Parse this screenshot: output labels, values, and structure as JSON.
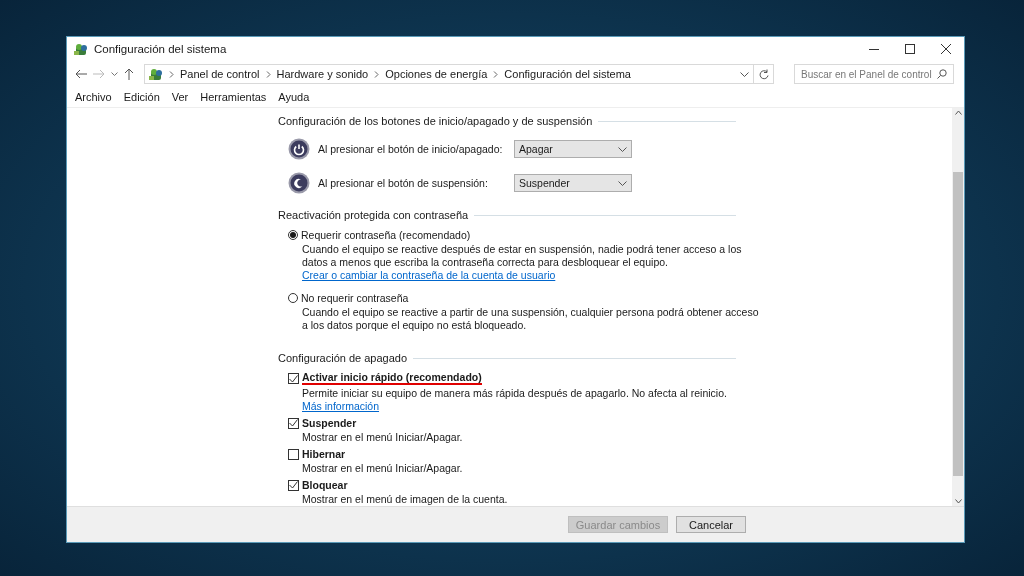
{
  "window": {
    "title": "Configuración del sistema"
  },
  "address": {
    "breadcrumbs": [
      "Panel de control",
      "Hardware y sonido",
      "Opciones de energía",
      "Configuración del sistema"
    ],
    "search": {
      "placeholder": "Buscar en el Panel de control"
    }
  },
  "menu": [
    "Archivo",
    "Edición",
    "Ver",
    "Herramientas",
    "Ayuda"
  ],
  "power_buttons": {
    "heading": "Configuración de los botones de inicio/apagado y de suspensión",
    "rows": [
      {
        "kind": "power",
        "label": "Al presionar el botón de inicio/apagado:",
        "value": "Apagar"
      },
      {
        "kind": "sleep",
        "label": "Al presionar el botón de suspensión:",
        "value": "Suspender"
      }
    ]
  },
  "password": {
    "heading": "Reactivación protegida con contraseña",
    "options": [
      {
        "label": "Requerir contraseña (recomendado)",
        "description": "Cuando el equipo se reactive después de estar en suspensión, nadie podrá tener acceso a los datos a menos que escriba la contraseña correcta para desbloquear el equipo.",
        "link": "Crear o cambiar la contraseña de la cuenta de usuario",
        "selected": true
      },
      {
        "label": "No requerir contraseña",
        "description": "Cuando el equipo se reactive a partir de una suspensión, cualquier persona podrá obtener acceso a los datos porque el equipo no está bloqueado.",
        "selected": false
      }
    ]
  },
  "shutdown": {
    "heading": "Configuración de apagado",
    "options": [
      {
        "label": "Activar inicio rápido (recomendado)",
        "description": "Permite iniciar su equipo de manera más rápida después de apagarlo. No afecta al reinicio.",
        "link": "Más información",
        "checked": true,
        "underlined": true
      },
      {
        "label": "Suspender",
        "description": "Mostrar en el menú Iniciar/Apagar.",
        "checked": true,
        "underlined": false
      },
      {
        "label": "Hibernar",
        "description": "Mostrar en el menú Iniciar/Apagar.",
        "checked": false,
        "underlined": false
      },
      {
        "label": "Bloquear",
        "description": "Mostrar en el menú de imagen de la cuenta.",
        "checked": true,
        "underlined": false
      }
    ]
  },
  "footer": {
    "buttons": [
      {
        "label": "Guardar cambios",
        "disabled": true
      },
      {
        "label": "Cancelar",
        "disabled": false
      }
    ]
  }
}
